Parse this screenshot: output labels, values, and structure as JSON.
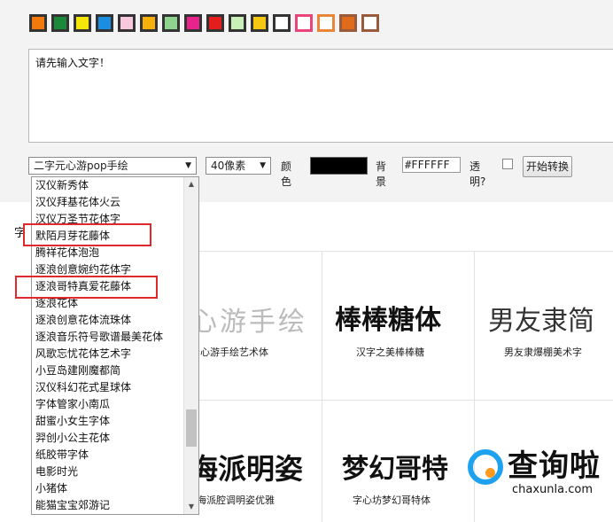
{
  "swatches": [
    {
      "name": "orange",
      "color": "#f27a0c",
      "frame": "dark"
    },
    {
      "name": "green",
      "color": "#1a8a3a",
      "frame": "dark"
    },
    {
      "name": "yellow",
      "color": "#f5e60a",
      "frame": "dark"
    },
    {
      "name": "blue",
      "color": "#1a8ee0",
      "frame": "dark"
    },
    {
      "name": "light-pink",
      "color": "#f8c8dc",
      "frame": "dark"
    },
    {
      "name": "amber",
      "color": "#f7b00a",
      "frame": "dark"
    },
    {
      "name": "light-green",
      "color": "#8ed48e",
      "frame": "dark"
    },
    {
      "name": "magenta",
      "color": "#e8248c",
      "frame": "dark"
    },
    {
      "name": "red",
      "color": "#e41e1e",
      "frame": "dark"
    },
    {
      "name": "pale-green",
      "color": "#c8f0b8",
      "frame": "dark"
    },
    {
      "name": "gold",
      "color": "#f5c814",
      "frame": "dark"
    },
    {
      "name": "white",
      "color": "#ffffff",
      "frame": "dark"
    },
    {
      "name": "white-pink-frame",
      "color": "#ffffff",
      "frame": "pink"
    },
    {
      "name": "white-orange-frame",
      "color": "#ffffff",
      "frame": "orange"
    },
    {
      "name": "orange-brown-frame",
      "color": "#e06b1a",
      "frame": "brown"
    },
    {
      "name": "white-brown-frame",
      "color": "#ffffff",
      "frame": "brown"
    }
  ],
  "input": {
    "text": "请先输入文字！"
  },
  "controls": {
    "font_select": "二字元心游pop手绘",
    "size_select": "40像素",
    "color_label": "颜色",
    "color_value": "#000000",
    "bg_label": "背景",
    "bg_value": "#FFFFFF",
    "transparent_label": "透明?",
    "start_button": "开始转换"
  },
  "side_char": "字",
  "dropdown": {
    "options": [
      "汉仪新秀体",
      "汉仪拜基花体火云",
      "汉仪万圣节花体字",
      "默陌月芽花藤体",
      "腾祥花体泡泡",
      "逐浪创意婉约花体字",
      "逐浪哥特真爱花藤体",
      "逐浪花体",
      "逐浪创意花体流珠体",
      "逐浪音乐符号歌谱最美花体",
      "风歌忘忧花体艺术字",
      "小豆岛建刚魔都简",
      "汉仪科幻花式星球体",
      "字体管家小南瓜",
      "甜蜜小女生字体",
      "羿创小公主花体",
      "纸胶带字体",
      "电影时光",
      "小猪体",
      "能猫宝宝郊游记"
    ]
  },
  "cards": [
    {
      "font_text": "心游手绘",
      "caption": "心游手绘艺术体"
    },
    {
      "font_text": "棒棒糖体",
      "caption": "汉字之美棒棒糖"
    },
    {
      "font_text": "男友隶简",
      "caption": "男友隶爆棚美术字"
    },
    {
      "font_text": "海派明姿",
      "caption": "海派腔调明姿优雅"
    },
    {
      "font_text": "梦幻哥特",
      "caption": "字心坊梦幻哥特体"
    }
  ],
  "watermark": {
    "text": "查询啦",
    "sub": "chaxunla.com",
    "ring_color": "#1ea2f0",
    "dot_color": "#ff9a1f"
  }
}
